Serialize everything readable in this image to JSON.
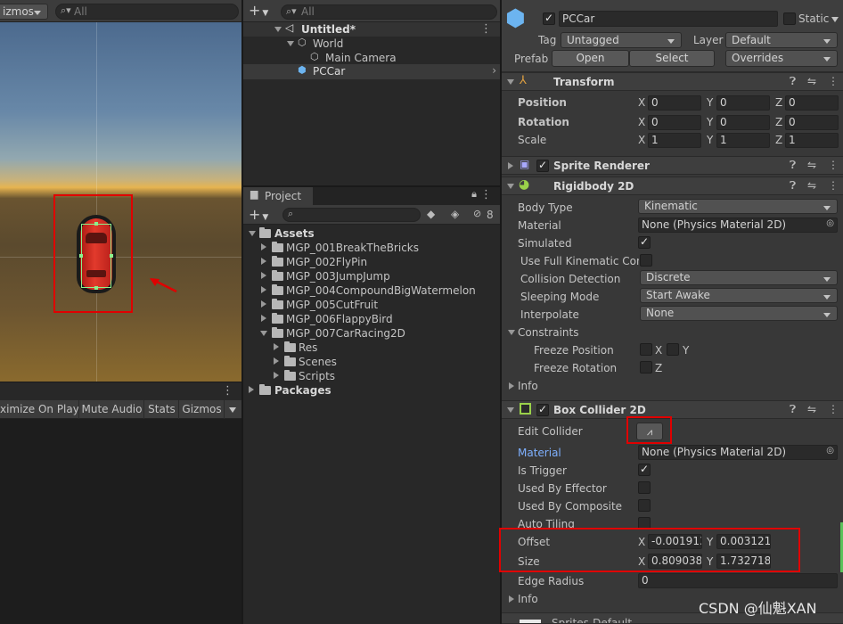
{
  "scene_toolbar": {
    "gizmos_label": "izmos",
    "search_placeholder": "All"
  },
  "game_toolbar": {
    "maximize_label": "ximize On Play",
    "mute_label": "Mute Audio",
    "stats_label": "Stats",
    "gizmos_label": "Gizmos"
  },
  "hierarchy": {
    "search_placeholder": "All",
    "scene_name": "Untitled*",
    "items": [
      {
        "label": "World"
      },
      {
        "label": "Main Camera"
      },
      {
        "label": "PCCar"
      }
    ]
  },
  "project": {
    "tab_label": "Project",
    "hidden_count": "8",
    "assets_label": "Assets",
    "folders": [
      {
        "label": "MGP_001BreakTheBricks"
      },
      {
        "label": "MGP_002FlyPin"
      },
      {
        "label": "MGP_003JumpJump"
      },
      {
        "label": "MGP_004CompoundBigWatermelon"
      },
      {
        "label": "MGP_005CutFruit"
      },
      {
        "label": "MGP_006FlappyBird"
      },
      {
        "label": "MGP_007CarRacing2D"
      },
      {
        "label": "Res"
      },
      {
        "label": "Scenes"
      },
      {
        "label": "Scripts"
      }
    ],
    "packages_label": "Packages"
  },
  "inspector": {
    "object_name": "PCCar",
    "static_label": "Static",
    "tag_label": "Tag",
    "tag_value": "Untagged",
    "layer_label": "Layer",
    "layer_value": "Default",
    "prefab_label": "Prefab",
    "open_label": "Open",
    "select_label": "Select",
    "overrides_label": "Overrides",
    "transform": {
      "title": "Transform",
      "position_label": "Position",
      "position": {
        "x": "0",
        "y": "0",
        "z": "0"
      },
      "rotation_label": "Rotation",
      "rotation": {
        "x": "0",
        "y": "0",
        "z": "0"
      },
      "scale_label": "Scale",
      "scale": {
        "x": "1",
        "y": "1",
        "z": "1"
      }
    },
    "sprite_renderer_title": "Sprite Renderer",
    "rigidbody": {
      "title": "Rigidbody 2D",
      "body_type_label": "Body Type",
      "body_type": "Kinematic",
      "material_label": "Material",
      "material": "None (Physics Material 2D)",
      "simulated_label": "Simulated",
      "full_kinematic_label": "Use Full Kinematic Cont",
      "collision_label": "Collision Detection",
      "collision": "Discrete",
      "sleeping_label": "Sleeping Mode",
      "sleeping": "Start Awake",
      "interpolate_label": "Interpolate",
      "interpolate": "None",
      "constraints_label": "Constraints",
      "freeze_pos_label": "Freeze Position",
      "freeze_rot_label": "Freeze Rotation",
      "info_label": "Info"
    },
    "box_collider": {
      "title": "Box Collider 2D",
      "edit_label": "Edit Collider",
      "material_label": "Material",
      "material": "None (Physics Material 2D)",
      "trigger_label": "Is Trigger",
      "effector_label": "Used By Effector",
      "composite_label": "Used By Composite",
      "tiling_label": "Auto Tiling",
      "offset_label": "Offset",
      "offset": {
        "x": "-0.001913",
        "y": "0.003121"
      },
      "size_label": "Size",
      "size": {
        "x": "0.809038",
        "y": "1.732718"
      },
      "edge_label": "Edge Radius",
      "edge": "0",
      "info_label": "Info"
    },
    "next_component": "Sprites-Default"
  },
  "axis": {
    "x": "X",
    "y": "Y",
    "z": "Z"
  },
  "watermark": "CSDN @仙魁XAN",
  "colors": {
    "red_highlight": "#e00000",
    "car_red": "#d42a1f",
    "material_link": "#7eb0ff"
  }
}
